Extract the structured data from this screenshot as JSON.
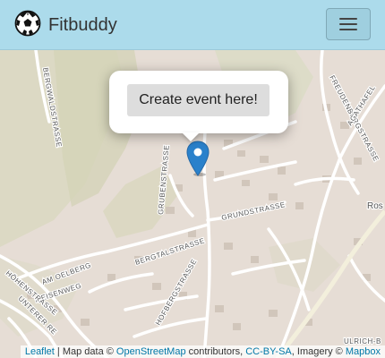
{
  "navbar": {
    "brand_name": "Fitbuddy",
    "brand_icon": "soccer-ball-icon",
    "toggle_icon": "hamburger-menu-icon"
  },
  "popup": {
    "button_label": "Create event here!"
  },
  "map": {
    "marker_icon": "map-pin-icon",
    "marker_color": "#2a81cb",
    "street_labels": {
      "bergwaldstrasse": "BERGWALDSTRASSE",
      "freudenbergstrasse": "FREUDENBERGSTRASSE",
      "agathafeld": "AGATHAFEL",
      "grubenstrasse": "GRUBENSTRASSE",
      "grundstrasse": "GRUNDSTRASSE",
      "bergtalstrasse": "BERGTALSTRASSE",
      "am_oelberg": "AM OELBERG",
      "meisenweg": "MEISENWEG",
      "hohenstrasse": "HÖHENSTRASSE",
      "unterer": "UNTERER RE",
      "hofbergstrasse": "HOFBERGSTRASSE",
      "ros": "Ros",
      "ulrich": "ULRICH-B"
    }
  },
  "attribution": {
    "leaflet": "Leaflet",
    "sep1": " | Map data © ",
    "osm": "OpenStreetMap",
    "contributors": " contributors, ",
    "license": "CC-BY-SA",
    "imagery": ", Imagery © ",
    "mapbox": "Mapbox"
  }
}
